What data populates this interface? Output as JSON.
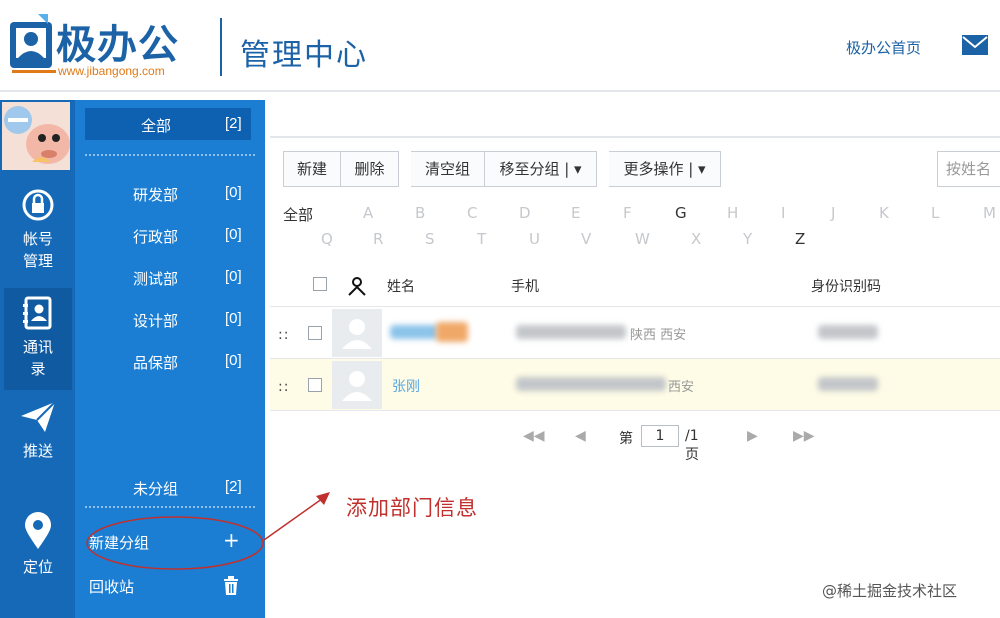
{
  "header": {
    "logo_text": "极办公",
    "logo_url": "www.jibangong.com",
    "title": "管理中心",
    "home_link": "极办公首页",
    "mail_icon": "mail-icon"
  },
  "leftnav": {
    "items": [
      {
        "label1": "帐号",
        "label2": "管理",
        "icon": "account-lock-icon"
      },
      {
        "label1": "通讯",
        "label2": "录",
        "icon": "contacts-icon"
      },
      {
        "label1": "推送",
        "label2": "",
        "icon": "paper-plane-icon"
      },
      {
        "label1": "定位",
        "label2": "",
        "icon": "location-pin-icon"
      }
    ]
  },
  "groups": {
    "all": {
      "label": "全部",
      "count": "[2]"
    },
    "items": [
      {
        "label": "研发部",
        "count": "[0]"
      },
      {
        "label": "行政部",
        "count": "[0]"
      },
      {
        "label": "测试部",
        "count": "[0]"
      },
      {
        "label": "设计部",
        "count": "[0]"
      },
      {
        "label": "品保部",
        "count": "[0]"
      }
    ],
    "ungrouped": {
      "label": "未分组",
      "count": "[2]"
    },
    "new_group": {
      "label": "新建分组",
      "icon": "+"
    },
    "recycle": {
      "label": "回收站",
      "icon": "trash-icon"
    }
  },
  "toolbar": {
    "new": "新建",
    "delete": "删除",
    "clear_group": "清空组",
    "move_group": "移至分组 | ▾",
    "more": "更多操作 | ▾",
    "search_placeholder": "按姓名"
  },
  "letters": {
    "all": "全部",
    "row1": [
      "A",
      "B",
      "C",
      "D",
      "E",
      "F",
      "G",
      "H",
      "I",
      "J",
      "K",
      "L",
      "M"
    ],
    "row2": [
      "Q",
      "R",
      "S",
      "T",
      "U",
      "V",
      "W",
      "X",
      "Y",
      "Z"
    ]
  },
  "table": {
    "headers": {
      "name": "姓名",
      "phone": "手机",
      "id": "身份识别码"
    },
    "rows": [
      {
        "name": "",
        "phone_suffix": "陕西 西安"
      },
      {
        "name": "张刚",
        "phone_suffix": "西安"
      }
    ]
  },
  "pager": {
    "prefix": "第",
    "page": "1",
    "suffix": "/1页"
  },
  "annotation": "添加部门信息",
  "watermark": "@稀土掘金技术社区"
}
